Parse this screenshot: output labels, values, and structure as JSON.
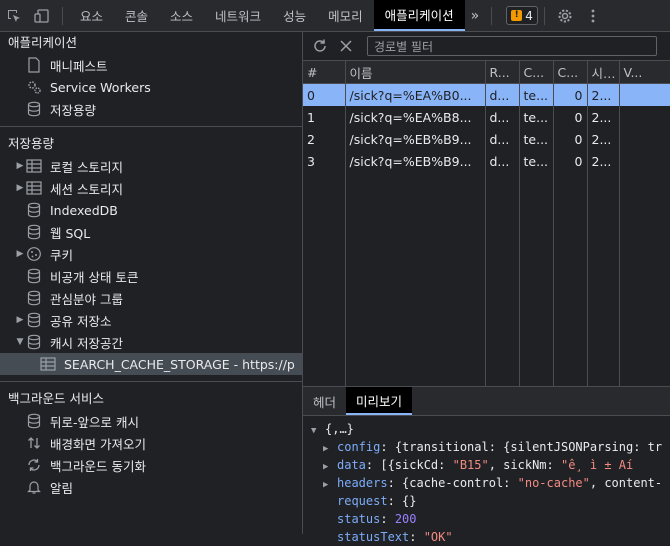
{
  "tabbar": {
    "tabs": [
      "요소",
      "콘솔",
      "소스",
      "네트워크",
      "성능",
      "메모리",
      "애플리케이션"
    ],
    "active_tab": "애플리케이션",
    "more": "»",
    "issues_count": "4"
  },
  "sidebar": {
    "app_section": {
      "title": "애플리케이션",
      "items": [
        "매니페스트",
        "Service Workers",
        "저장용량"
      ]
    },
    "storage_section": {
      "title": "저장용량",
      "items": [
        "로컬 스토리지",
        "세션 스토리지",
        "IndexedDB",
        "웹 SQL",
        "쿠키",
        "비공개 상태 토큰",
        "관심분야 그룹",
        "공유 저장소",
        "캐시 저장공간"
      ],
      "selected_child": "SEARCH_CACHE_STORAGE - https://p"
    },
    "bg_section": {
      "title": "백그라운드 서비스",
      "items": [
        "뒤로-앞으로 캐시",
        "배경화면 가져오기",
        "백그라운드 동기화",
        "알림"
      ]
    }
  },
  "toolbar": {
    "filter_placeholder": "경로별 필터"
  },
  "cache_table": {
    "columns": [
      "#",
      "이름",
      "R...",
      "C...",
      "C...",
      "시...",
      "V..."
    ],
    "rows": [
      [
        "0",
        "/sick?q=%EA%B0...",
        "d...",
        "te...",
        "0",
        "2...",
        ""
      ],
      [
        "1",
        "/sick?q=%EA%B8...",
        "d...",
        "te...",
        "0",
        "2...",
        ""
      ],
      [
        "2",
        "/sick?q=%EB%B9...",
        "d...",
        "te...",
        "0",
        "2...",
        ""
      ],
      [
        "3",
        "/sick?q=%EB%B9...",
        "d...",
        "te...",
        "0",
        "2...",
        ""
      ]
    ],
    "selected_row": 0
  },
  "detail": {
    "tabs": [
      "헤더",
      "미리보기"
    ],
    "active_tab": "미리보기",
    "preview": {
      "root": "{,…}",
      "config_key": "config",
      "config_val": "{transitional: {silentJSONParsing: tr",
      "data_key": "data",
      "data_val_prefix": "[{sickCd: ",
      "data_val_code": "\"B15\"",
      "data_val_mid": ", sickNm: ",
      "data_val_name": "\"ê¸ ì ± Aí",
      "headers_key": "headers",
      "headers_val_prefix": "{cache-control: ",
      "headers_val_str": "\"no-cache\"",
      "headers_val_suffix": ", content-",
      "request_key": "request",
      "request_val": "{}",
      "status_key": "status",
      "status_val": "200",
      "statusText_key": "statusText",
      "statusText_val": "\"OK\""
    }
  }
}
